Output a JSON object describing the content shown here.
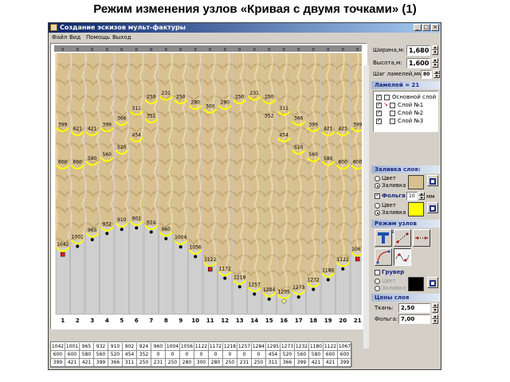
{
  "slide": {
    "title": "Режим изменения узлов «Кривая с двумя точками» (1)"
  },
  "window": {
    "title": "Создание эскизов мульт-фактуры",
    "buttons": {
      "minimize": "_",
      "maximize": "□",
      "close": "×"
    }
  },
  "menu": {
    "items": [
      "Файл",
      "Вид",
      "Помощь",
      "Выход"
    ]
  },
  "chart_data": {
    "type": "line",
    "x": [
      1,
      2,
      3,
      4,
      5,
      6,
      7,
      8,
      9,
      10,
      11,
      12,
      13,
      14,
      15,
      16,
      17,
      18,
      19,
      20,
      21
    ],
    "top_markers": [
      "0",
      "0",
      "0",
      "0",
      "0",
      "0",
      "0",
      "0",
      "0",
      "0",
      "0",
      "0",
      "0",
      "0",
      "0",
      "0",
      "0",
      "0",
      "0",
      "0",
      "0"
    ],
    "series": [
      {
        "values": [
          1042,
          1001,
          965,
          932,
          910,
          902,
          924,
          960,
          1004,
          1056,
          1122,
          1172,
          1218,
          1257,
          1284,
          1295,
          1273,
          1232,
          1180,
          1122,
          1067
        ],
        "color": "#000000"
      },
      {
        "values": [
          600,
          600,
          580,
          560,
          520,
          454,
          352,
          0,
          0,
          0,
          0,
          0,
          0,
          0,
          0,
          454,
          520,
          560,
          580,
          600,
          600
        ],
        "color": "#ffff00"
      },
      {
        "values": [
          399,
          421,
          421,
          399,
          366,
          311,
          250,
          231,
          250,
          280,
          300,
          280,
          250,
          231,
          250,
          311,
          366,
          399,
          421,
          421,
          399
        ],
        "color": "#ffff00"
      }
    ],
    "upper_labels": [
      "399",
      "421",
      "421",
      "399",
      "366",
      "311",
      "250",
      "231",
      "250",
      "280",
      "300",
      "280",
      "250",
      "231",
      "250",
      "311",
      "366",
      "399",
      "421",
      "421",
      "399"
    ],
    "middle_labels": [
      "600",
      "600",
      "580",
      "560",
      "520",
      "454",
      "352",
      "",
      "",
      "",
      "",
      "",
      "",
      "",
      "352",
      "454",
      "520",
      "560",
      "580",
      "600",
      "600"
    ],
    "lower_labels": [
      "1042",
      "1001",
      "965",
      "932",
      "910",
      "902",
      "924",
      "960",
      "1004",
      "1056",
      "1122",
      "1172",
      "1218",
      "1257",
      "1284",
      "1295",
      "1273",
      "1232",
      "1180",
      "1122",
      "1067"
    ],
    "column_numbers": [
      "1",
      "2",
      "3",
      "4",
      "5",
      "6",
      "7",
      "8",
      "9",
      "10",
      "11",
      "12",
      "13",
      "14",
      "15",
      "16",
      "17",
      "18",
      "19",
      "20",
      "21"
    ],
    "ylim": [
      0,
      1400
    ]
  },
  "table": {
    "rows": [
      [
        "1042",
        "1001",
        "965",
        "932",
        "910",
        "902",
        "924",
        "960",
        "1004",
        "1056",
        "1122",
        "1172",
        "1218",
        "1257",
        "1284",
        "1295",
        "1273",
        "1232",
        "1180",
        "1122",
        "1067"
      ],
      [
        "600",
        "600",
        "580",
        "560",
        "520",
        "454",
        "352",
        "0",
        "0",
        "0",
        "0",
        "0",
        "0",
        "0",
        "0",
        "454",
        "520",
        "560",
        "580",
        "600",
        "600"
      ],
      [
        "399",
        "421",
        "421",
        "399",
        "366",
        "311",
        "250",
        "231",
        "250",
        "280",
        "300",
        "280",
        "250",
        "231",
        "250",
        "311",
        "366",
        "399",
        "421",
        "421",
        "399"
      ]
    ]
  },
  "panel": {
    "width_label": "Ширина,м:",
    "width_value": "1,680",
    "height_label": "Высота,м:",
    "height_value": "1,600",
    "step_label": "Шаг ламелей,мм:",
    "step_value": "80",
    "lamels_header": "Ламелей = 21",
    "layers": [
      "Основной слой",
      "Слой №1",
      "Слой №2",
      "Слой №3"
    ],
    "fill_header": "Заливка слоя:",
    "color_label": "Цвет",
    "fill_label": "Заливка",
    "foil_label": "Фольга",
    "foil_value": "10",
    "foil_unit": "мм",
    "mode_header": "Режим узлов эскиза",
    "gruver_label": "Грувер",
    "prices_header": "Цены слоя",
    "fabric_label": "Ткань:",
    "fabric_value": "2,50",
    "foil_price_label": "Фольга:",
    "foil_price_value": "7,00"
  },
  "colors": {
    "fabric": "#d8c090",
    "yellow": "#ffff00",
    "black": "#000000"
  }
}
